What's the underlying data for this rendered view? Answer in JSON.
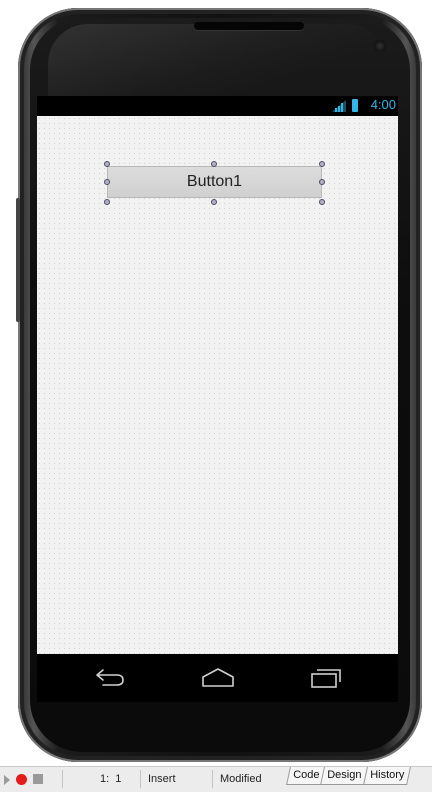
{
  "status_bar": {
    "time": "4:00",
    "accent_color": "#33b5e5"
  },
  "designer": {
    "button_text": "Button1"
  },
  "nav_bar": {
    "icons": [
      "back-icon",
      "home-icon",
      "recent-apps-icon"
    ]
  },
  "ide_status": {
    "cursor_position": "1:  1",
    "mode": "Insert",
    "state": "Modified",
    "tabs": [
      "Code",
      "Design",
      "History"
    ],
    "record_color": "#e41b1b"
  }
}
